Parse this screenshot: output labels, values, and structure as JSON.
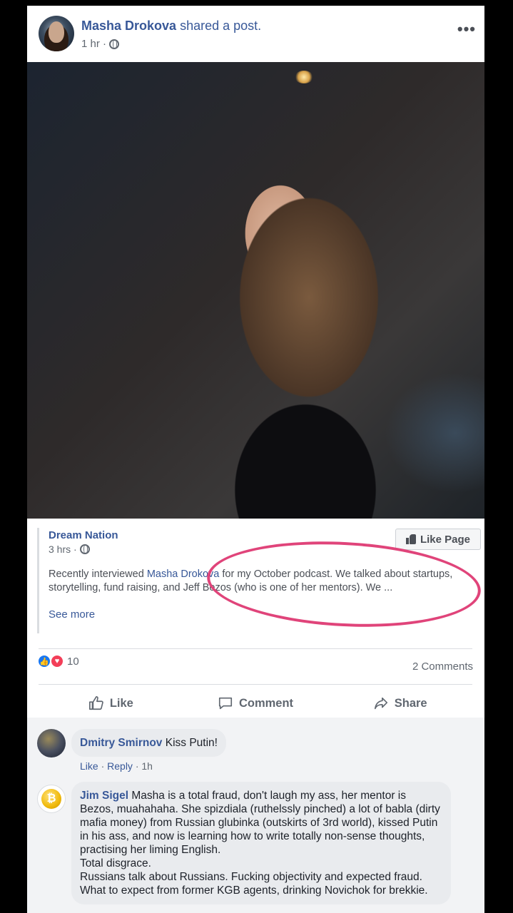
{
  "post": {
    "author": "Masha Drokova",
    "action": "shared a post.",
    "time": "1 hr ·",
    "more": "•••"
  },
  "shared": {
    "page_name": "Dream Nation",
    "time": "3 hrs ·",
    "like_page": "Like Page",
    "text_before": "Recently interviewed ",
    "mention": "Masha Drokova",
    "text_after": " for my October podcast. We talked about startups, storytelling, fund raising, and Jeff Bezos (who is one of her mentors). We ...",
    "see_more": "See more"
  },
  "reactions": {
    "count": "10",
    "comments": "2 Comments",
    "colors": {
      "like": "#1877f2",
      "love": "#f33e58"
    }
  },
  "actions": {
    "like": "Like",
    "comment": "Comment",
    "share": "Share"
  },
  "comments": [
    {
      "name": "Dmitry Smirnov",
      "text": "Kiss Putin!",
      "like": "Like",
      "reply": "Reply",
      "time": "1h"
    },
    {
      "name": "Jim Sigel",
      "text": "Masha is a total fraud, don't laugh my ass, her mentor is Bezos, muahahaha. She spizdiala (ruthelssly pinched) a lot of babla (dirty mafia money) from Russian glubinka (outskirts of 3rd world), kissed Putin in his ass, and now is learning how to write totally non-sense thoughts, practising her liming English.\nTotal disgrace.\nRussians talk about Russians. Fucking objectivity and expected fraud. What to expect from former KGB agents, drinking Novichok for brekkie."
    }
  ],
  "annotation_color": "#e0447a"
}
